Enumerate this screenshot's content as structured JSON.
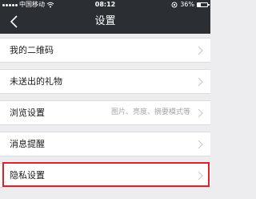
{
  "status_bar": {
    "carrier": "中国移动",
    "time": "08:12",
    "battery": "36%",
    "battery_level": 0.36
  },
  "header": {
    "title": "设置"
  },
  "settings": {
    "items": [
      {
        "label": "我的二维码",
        "desc": ""
      },
      {
        "label": "未送出的礼物",
        "desc": ""
      },
      {
        "label": "浏览设置",
        "desc": "图片、亮度、摘要模式等"
      },
      {
        "label": "消息提醒",
        "desc": ""
      },
      {
        "label": "隐私设置",
        "desc": ""
      }
    ]
  },
  "colors": {
    "navbar": "#2b2e33",
    "background": "#ededf0",
    "highlight": "#e0202a"
  },
  "icons": [
    "signal-dots-icon",
    "wifi-icon",
    "back-arrow-icon",
    "chevron-right-icon",
    "rotation-lock-icon",
    "battery-icon"
  ]
}
